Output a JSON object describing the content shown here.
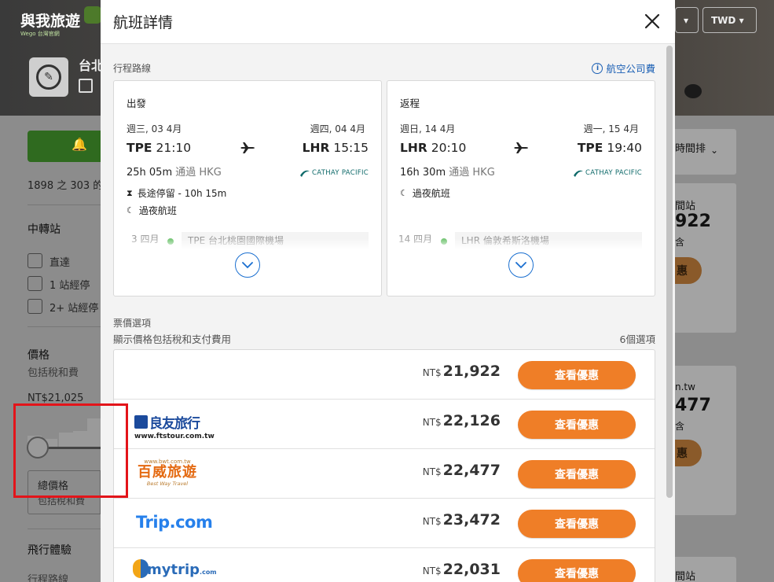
{
  "background": {
    "logo_text": "與我旅遊",
    "logo_sub": "Wego 台灣官網",
    "city": "台北",
    "currency_select": "TWD",
    "left": {
      "results_count": "1898 之 303 的",
      "transfer_title": "中轉站",
      "stops": [
        "直達",
        "1 站經停",
        "2+ 站經停"
      ],
      "price_title": "價格",
      "price_sub": "包括稅和費",
      "price_min": "NT$21,025",
      "total_title": "總價格",
      "total_sub": "包括稅和費",
      "experience_title": "飛行體驗",
      "route_title": "行程路線"
    },
    "right": {
      "sort_label": "時間排",
      "cards": [
        {
          "label": "間站",
          "price": "922",
          "btn": "惠"
        },
        {
          "label": "n.tw",
          "price": "477",
          "btn": "惠"
        }
      ],
      "bottom_label": "間站"
    }
  },
  "modal": {
    "title": "航班詳情",
    "route_label": "行程路線",
    "airline_fee_label": "航空公司費",
    "outbound": {
      "direction": "出發",
      "dep_date": "週三, 03 4月",
      "arr_date": "週四, 04 4月",
      "dep_code": "TPE",
      "dep_time": "21:10",
      "arr_code": "LHR",
      "arr_time": "15:15",
      "duration": "25h 05m",
      "via": "通過 HKG",
      "carrier": "CATHAY PACIFIC",
      "layover": "長途停留 - 10h 15m",
      "overnight": "過夜航班",
      "detail_date": "3 四月",
      "detail_airport": "TPE 台北桃園國際機場"
    },
    "inbound": {
      "direction": "返程",
      "dep_date": "週日, 14 4月",
      "arr_date": "週一, 15 4月",
      "dep_code": "LHR",
      "dep_time": "20:10",
      "arr_code": "TPE",
      "arr_time": "19:40",
      "duration": "16h 30m",
      "via": "通過 HKG",
      "carrier": "CATHAY PACIFIC",
      "overnight": "過夜航班",
      "detail_date": "14 四月",
      "detail_airport": "LHR 倫敦希斯洛機場"
    },
    "fare_label": "票價選項",
    "fare_sub": "顯示價格包括稅和支付費用",
    "option_count": "6個選項",
    "currency": "NT$",
    "deal_label": "查看優惠",
    "offers": [
      {
        "agent": "",
        "price": "21,922"
      },
      {
        "agent": "良友旅行",
        "agent_url": "www.ftstour.com.tw",
        "price": "22,126"
      },
      {
        "agent": "百威旅遊",
        "agent_url": "www.bwt.com.tw",
        "agent_tag": "Best Way Travel",
        "price": "22,477"
      },
      {
        "agent": "Trip.com",
        "price": "23,472"
      },
      {
        "agent": "mytrip",
        "agent_suffix": ".com",
        "price": "22,031"
      }
    ],
    "colors": {
      "accent": "#ef7e27",
      "link": "#1a5fb4",
      "highlight": "#e3141a"
    }
  }
}
